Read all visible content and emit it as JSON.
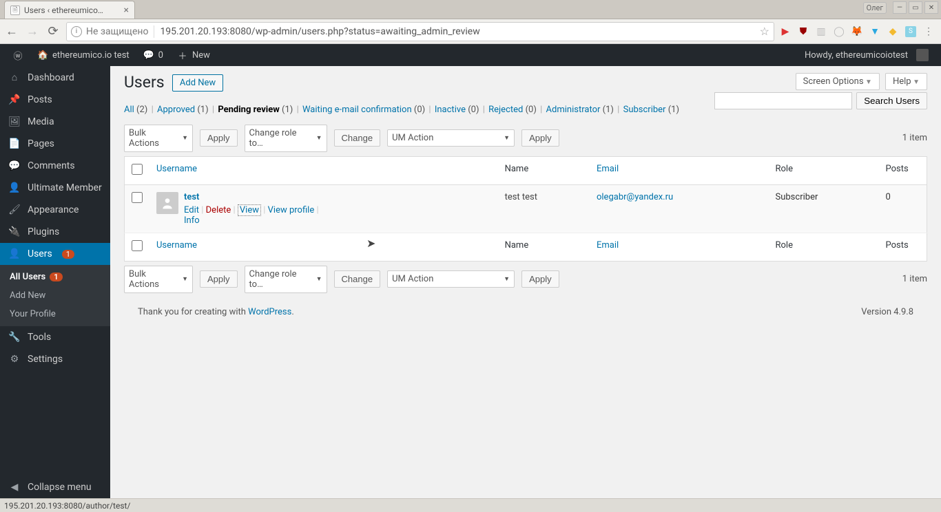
{
  "browser": {
    "tab_title": "Users ‹ ethereumico…",
    "user_label": "Олег",
    "not_secure": "Не защищено",
    "url": "195.201.20.193:8080/wp-admin/users.php?status=awaiting_admin_review",
    "status_url": "195.201.20.193:8080/author/test/"
  },
  "adminbar": {
    "site_name": "ethereumico.io test",
    "comments": "0",
    "new_label": "New",
    "howdy": "Howdy, ethereumicoiotest"
  },
  "menu": {
    "dashboard": "Dashboard",
    "posts": "Posts",
    "media": "Media",
    "pages": "Pages",
    "comments": "Comments",
    "ultimate_member": "Ultimate Member",
    "appearance": "Appearance",
    "plugins": "Plugins",
    "users": "Users",
    "users_badge": "1",
    "tools": "Tools",
    "settings": "Settings",
    "collapse": "Collapse menu",
    "sub": {
      "all_users": "All Users",
      "all_users_badge": "1",
      "add_new": "Add New",
      "profile": "Your Profile"
    }
  },
  "page": {
    "title": "Users",
    "add_new": "Add New",
    "screen_options": "Screen Options",
    "help": "Help",
    "search_button": "Search Users",
    "items_count": "1 item",
    "footer_text": "Thank you for creating with ",
    "footer_link": "WordPress",
    "version": "Version 4.9.8"
  },
  "filters": {
    "all": "All",
    "all_count": "(2)",
    "approved": "Approved",
    "approved_count": "(1)",
    "pending": "Pending review",
    "pending_count": "(1)",
    "waiting": "Waiting e-mail confirmation",
    "waiting_count": "(0)",
    "inactive": "Inactive",
    "inactive_count": "(0)",
    "rejected": "Rejected",
    "rejected_count": "(0)",
    "admin": "Administrator",
    "admin_count": "(1)",
    "subscriber": "Subscriber",
    "subscriber_count": "(1)"
  },
  "actions": {
    "bulk": "Bulk Actions",
    "apply": "Apply",
    "change_role": "Change role to…",
    "change": "Change",
    "um_action": "UM Action"
  },
  "table": {
    "cols": {
      "username": "Username",
      "name": "Name",
      "email": "Email",
      "role": "Role",
      "posts": "Posts"
    },
    "row": {
      "username": "test",
      "name": "test test",
      "email": "olegabr@yandex.ru",
      "role": "Subscriber",
      "posts": "0",
      "edit": "Edit",
      "delete": "Delete",
      "view": "View",
      "view_profile": "View profile",
      "info": "Info"
    }
  }
}
